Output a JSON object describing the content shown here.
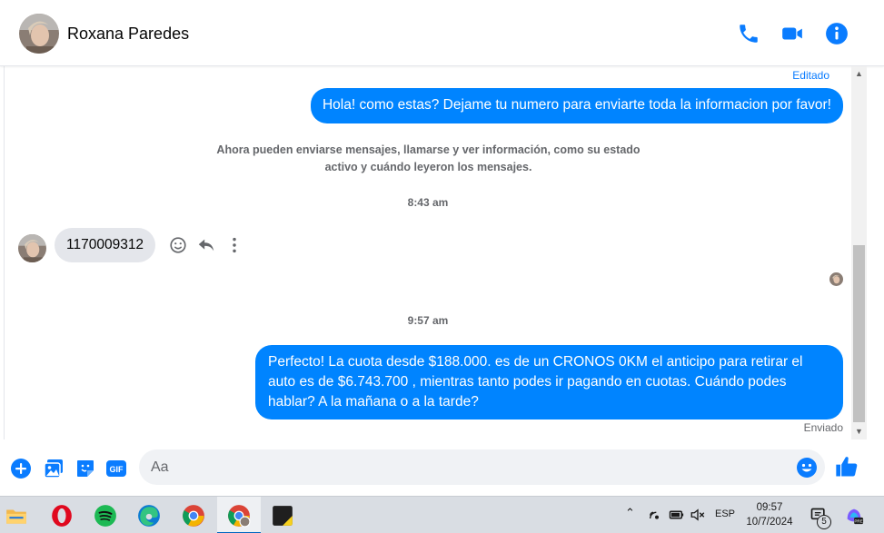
{
  "contact": {
    "name": "Roxana Paredes"
  },
  "header_actions": {
    "call_icon": "phone-icon",
    "video_icon": "video-camera-icon",
    "info_icon": "info-icon"
  },
  "messages": {
    "edited_label": "Editado",
    "outgoing_1": "Hola! como estas? Dejame tu numero para enviarte toda la informacion por favor!",
    "system_notice": "Ahora pueden enviarse mensajes, llamarse y ver información, como su estado activo y cuándo leyeron los mensajes.",
    "time_1": "8:43 am",
    "incoming_1": "1170009312",
    "time_2": "9:57 am",
    "outgoing_2": "Perfecto! La cuota desde $188.000. es de un CRONOS 0KM el anticipo para retirar el auto es de $6.743.700 , mientras tanto podes ir pagando en cuotas. Cuándo podes hablar? A la mañana o a la tarde?",
    "sent_label": "Enviado"
  },
  "composer": {
    "placeholder": "Aa"
  },
  "taskbar": {
    "lang": "ESP",
    "time": "09:57",
    "date": "10/7/2024",
    "notification_count": "5",
    "apps": [
      "file-explorer-icon",
      "opera-icon",
      "spotify-icon",
      "edge-icon",
      "chrome-icon",
      "chrome-profile-icon",
      "sticky-app-icon"
    ]
  },
  "colors": {
    "accent": "#0084ff",
    "icon_blue": "#0a7cff",
    "incoming_bubble": "#e4e6eb",
    "taskbar": "#d9dde3"
  }
}
